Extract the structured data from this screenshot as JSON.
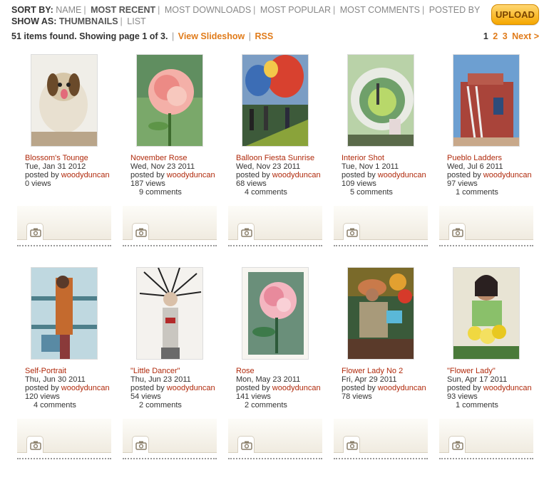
{
  "sort": {
    "label": "SORT BY:",
    "options": [
      "NAME",
      "MOST RECENT",
      "MOST DOWNLOADS",
      "MOST POPULAR",
      "MOST COMMENTS",
      "POSTED BY"
    ],
    "active": "MOST RECENT"
  },
  "show": {
    "label": "SHOW AS:",
    "options": [
      "THUMBNAILS",
      "LIST"
    ],
    "active": "THUMBNAILS"
  },
  "upload_label": "UPLOAD",
  "info": {
    "count_text": "51 items found. Showing page 1 of 3.",
    "slideshow": "View Slideshow",
    "rss": "RSS"
  },
  "pager": {
    "pages": [
      "1",
      "2",
      "3"
    ],
    "next": "Next >",
    "current": "1"
  },
  "items": [
    {
      "title": "Blossom's Tounge",
      "date": "Tue, Jan 31 2012",
      "posted_by": "posted by",
      "user": "woodyduncan",
      "views": "0 views",
      "comments": ""
    },
    {
      "title": "November Rose",
      "date": "Wed, Nov 23 2011",
      "posted_by": "posted by",
      "user": "woodyduncan",
      "views": "187 views",
      "comments": "9 comments"
    },
    {
      "title": "Balloon Fiesta Sunrise",
      "date": "Wed, Nov 23 2011",
      "posted_by": "posted by",
      "user": "woodyduncan",
      "views": "68 views",
      "comments": "4 comments"
    },
    {
      "title": "Interior Shot",
      "date": "Tue, Nov 1 2011",
      "posted_by": "posted by",
      "user": "woodyduncan",
      "views": "109 views",
      "comments": "5 comments"
    },
    {
      "title": "Pueblo Ladders",
      "date": "Wed, Jul 6 2011",
      "posted_by": "posted by",
      "user": "woodyduncan",
      "views": "97 views",
      "comments": "1 comments"
    },
    {
      "title": "Self-Portrait",
      "date": "Thu, Jun 30 2011",
      "posted_by": "posted by",
      "user": "woodyduncan",
      "views": "120 views",
      "comments": "4 comments"
    },
    {
      "title": "\"Little Dancer\"",
      "date": "Thu, Jun 23 2011",
      "posted_by": "posted by",
      "user": "woodyduncan",
      "views": "54 views",
      "comments": "2 comments"
    },
    {
      "title": "Rose",
      "date": "Mon, May 23 2011",
      "posted_by": "posted by",
      "user": "woodyduncan",
      "views": "141 views",
      "comments": "2 comments"
    },
    {
      "title": "Flower Lady No 2",
      "date": "Fri, Apr 29 2011",
      "posted_by": "posted by",
      "user": "woodyduncan",
      "views": "78 views",
      "comments": ""
    },
    {
      "title": "\"Flower Lady\"",
      "date": "Sun, Apr 17 2011",
      "posted_by": "posted by",
      "user": "woodyduncan",
      "views": "93 views",
      "comments": "1 comments"
    }
  ],
  "colors": {
    "accent_orange": "#e07b1a",
    "link_red": "#b02a0c",
    "upload_gold": "#f5a700"
  },
  "icons": {
    "tray_icon": "camera-icon"
  }
}
